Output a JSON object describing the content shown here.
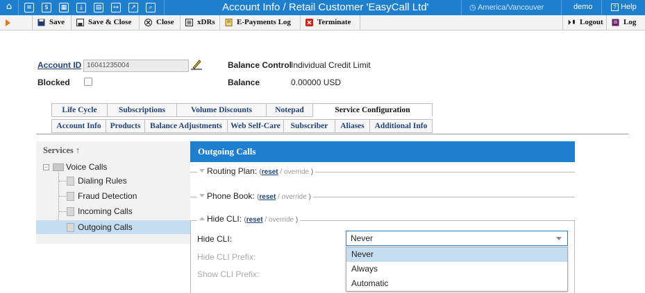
{
  "window": {
    "title": "Account Info / Retail Customer 'EasyCall Ltd'",
    "timezone": "America/Vancouver",
    "user": "demo",
    "help_label": "Help",
    "top_icons": [
      "home-icon",
      "list-icon",
      "dollar-icon",
      "grid-icon",
      "download-icon",
      "table-icon",
      "export-icon",
      "chart-icon",
      "search-icon"
    ],
    "accent_color": "#1f7fcf"
  },
  "toolbar": {
    "save_label": "Save",
    "save_close_label": "Save & Close",
    "close_label": "Close",
    "xdrs_label": "xDRs",
    "epayments_label": "E-Payments Log",
    "terminate_label": "Terminate",
    "logout_label": "Logout",
    "log_label": "Log"
  },
  "account": {
    "id_label": "Account ID",
    "id_value": "16041235004",
    "blocked_label": "Blocked",
    "balance_control_label": "Balance Control",
    "balance_control_value": "Individual Credit Limit",
    "balance_label": "Balance",
    "balance_value": "0.00000 USD"
  },
  "tabs_top": [
    "Life Cycle",
    "Subscriptions",
    "Volume Discounts",
    "Notepad",
    "Service Configuration"
  ],
  "tabs_bottom": [
    "Account Info",
    "Products",
    "Balance Adjustments",
    "Web Self-Care",
    "Subscriber",
    "Aliases",
    "Additional Info"
  ],
  "services": {
    "header": "Services ↑",
    "root": "Voice Calls",
    "items": [
      "Dialing Rules",
      "Fraud Detection",
      "Incoming Calls",
      "Outgoing Calls"
    ]
  },
  "panel": {
    "title": "Outgoing Calls",
    "routing_plan_label": "Routing Plan:",
    "phone_book_label": "Phone Book:",
    "hide_cli_section_label": "Hide CLI:",
    "reset_label": "reset",
    "override_label": "override",
    "hide_cli_field_label": "Hide CLI:",
    "hide_cli_prefix_label": "Hide CLI Prefix:",
    "show_cli_prefix_label": "Show CLI Prefix:",
    "hide_cli_value": "Never",
    "hide_cli_options": [
      "Never",
      "Always",
      "Automatic"
    ]
  }
}
